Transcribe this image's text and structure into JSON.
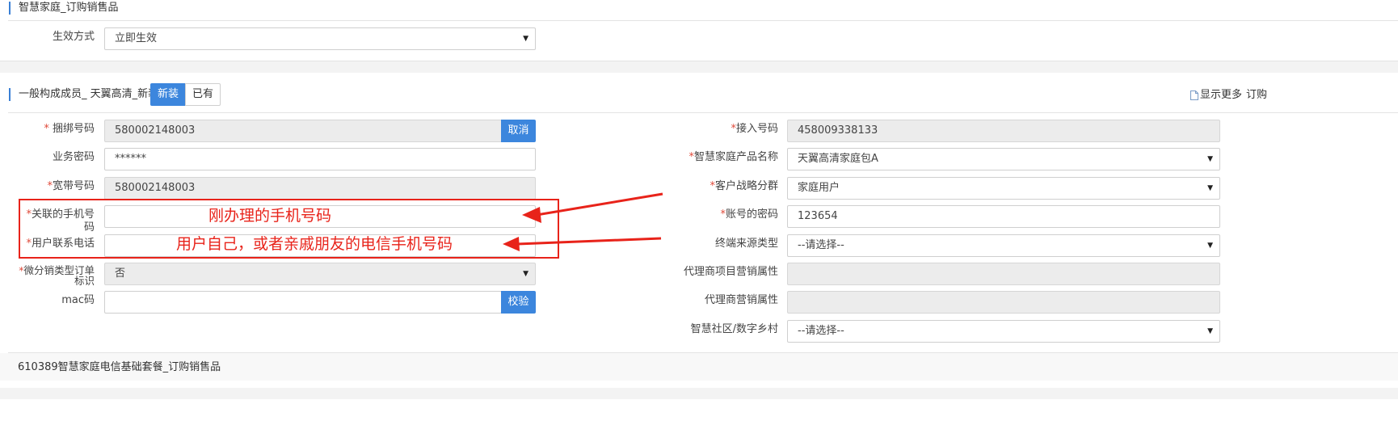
{
  "section1": {
    "title": "智慧家庭_订购销售品",
    "effect_label": "生效方式",
    "effect_value": "立即生效"
  },
  "section2": {
    "title": "一般构成成员_ 天翼高清_新装",
    "toggle_new": "新装",
    "toggle_existing": "已有",
    "show_more": "显示更多",
    "order_link": "订购",
    "left": {
      "bind_label": "捆绑号码",
      "bind_value": "580002148003",
      "cancel": "取消",
      "pwd_label": "业务密码",
      "pwd_value": "******",
      "bb_label": "宽带号码",
      "bb_value": "580002148003",
      "mobile_label": "关联的手机号码",
      "contact_label": "用户联系电话",
      "micro_label": "微分销类型订单标识",
      "micro_value": "否",
      "mac_label": "mac码",
      "verify": "校验"
    },
    "right": {
      "access_label": "接入号码",
      "access_value": "458009338133",
      "product_label": "智慧家庭产品名称",
      "product_value": "天翼高清家庭包A",
      "strategy_label": "客户战略分群",
      "strategy_value": "家庭用户",
      "acct_pwd_label": "账号的密码",
      "acct_pwd_value": "123654",
      "terminal_label": "终端来源类型",
      "terminal_value": "--请选择--",
      "agent_proj_label": "代理商项目营销属性",
      "agent_label": "代理商营销属性",
      "community_label": "智慧社区/数字乡村",
      "community_value": "--请选择--"
    }
  },
  "annotations": {
    "mobile_note": "刚办理的手机号码",
    "contact_note": "用户自己，或者亲戚朋友的电信手机号码",
    "color": "#e8231a"
  },
  "section3": {
    "title": "610389智慧家庭电信基础套餐_订购销售品"
  },
  "icons": [
    "document-icon",
    "dropdown-arrow-icon",
    "red-arrow-icon"
  ]
}
